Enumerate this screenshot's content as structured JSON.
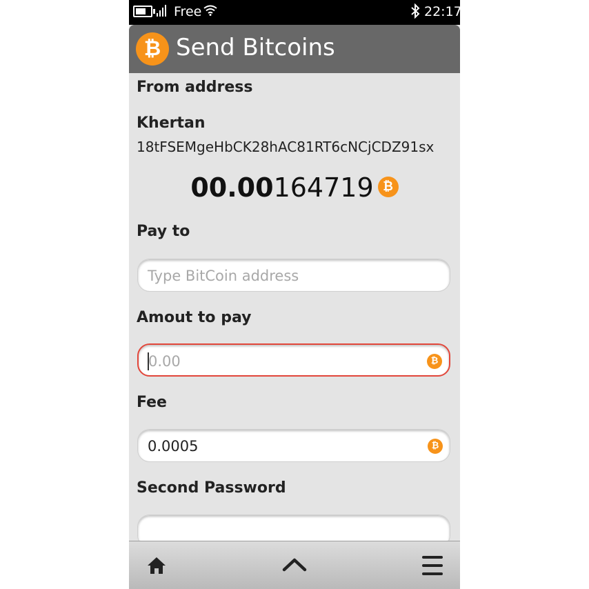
{
  "status_bar": {
    "carrier": "Free",
    "time": "22:17",
    "icons": [
      "battery-icon",
      "signal-icon",
      "wifi-icon",
      "bluetooth-icon"
    ]
  },
  "header": {
    "title": "Send Bitcoins",
    "logo_icon": "bitcoin-icon",
    "logo_symbol": "₿"
  },
  "from": {
    "label": "From address",
    "name": "Khertan",
    "address": "18tFSEMgeHbCK28hAC81RT6cNCjCDZ91sx",
    "balance_bold": "00.00",
    "balance_rest": "164719"
  },
  "pay_to": {
    "label": "Pay to",
    "placeholder": "Type BitCoin address",
    "value": ""
  },
  "amount": {
    "label": "Amout to pay",
    "placeholder": "0.00",
    "value": ""
  },
  "fee": {
    "label": "Fee",
    "value": "0.0005"
  },
  "second_password": {
    "label": "Second Password",
    "value": ""
  },
  "toolbar": {
    "icons": [
      "home-icon",
      "chevron-up-icon",
      "menu-icon"
    ]
  },
  "colors": {
    "bitcoin_orange": "#f7931a",
    "header_bg": "#686868",
    "active_border": "#e2463a",
    "page_bg": "#e4e4e4"
  }
}
